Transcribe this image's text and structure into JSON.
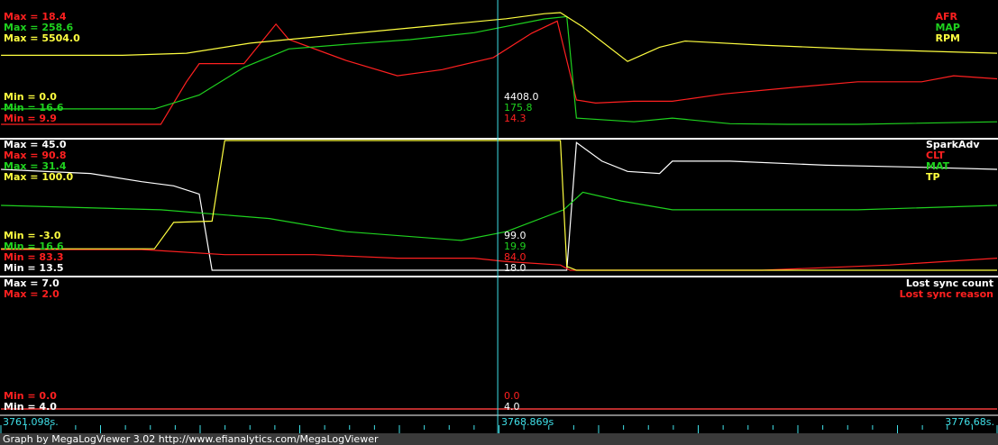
{
  "footer": "Graph by MegaLogViewer 3.02 http://www.efianalytics.com/MegaLogViewer",
  "colors": {
    "red": "#ff2020",
    "green": "#1fd21f",
    "yellow": "#ffff40",
    "white": "#ffffff",
    "cyan": "#40e0e8"
  },
  "time_axis": {
    "start": "3761.098s.",
    "cursor": "3768.869s",
    "end": "3776.68s."
  },
  "panel1": {
    "legend": [
      "AFR",
      "MAP",
      "RPM"
    ],
    "max": [
      "Max = 18.4",
      "Max = 258.6",
      "Max = 5504.0"
    ],
    "min": [
      "Min = 0.0",
      "Min = 16.6",
      "Min = 9.9"
    ],
    "cursor": [
      "4408.0",
      "175.8",
      "14.3"
    ]
  },
  "panel2": {
    "legend": [
      "SparkAdv",
      "CLT",
      "MAT",
      "TP"
    ],
    "max": [
      "Max = 45.0",
      "Max = 90.8",
      "Max = 31.4",
      "Max = 100.0"
    ],
    "min": [
      "Min = -3.0",
      "Min = 16.6",
      "Min = 83.3",
      "Min = 13.5"
    ],
    "cursor": [
      "99.0",
      "19.9",
      "84.0",
      "18.0"
    ]
  },
  "panel3": {
    "legend": [
      "Lost sync count",
      "Lost sync reason"
    ],
    "max": [
      "Max = 7.0",
      "Max = 2.0"
    ],
    "min": [
      "Min = 0.0",
      "Min = 4.0"
    ],
    "cursor": [
      "0.0",
      "4.0"
    ]
  },
  "chart_data": {
    "type": "line",
    "x_range": [
      3761.098,
      3776.68
    ],
    "cursor_x": 3768.869,
    "panels": [
      {
        "series": [
          {
            "name": "AFR",
            "color": "#ff2020",
            "min": 0.0,
            "max": 18.4,
            "x": [
              3761.1,
              3763.6,
              3764.0,
              3764.2,
              3764.9,
              3765.4,
              3765.6,
              3766.5,
              3767.3,
              3768.0,
              3768.8,
              3769.4,
              3769.8,
              3770.1,
              3770.4,
              3771.0,
              3771.6,
              3772.4,
              3773.4,
              3774.5,
              3775.5,
              3776.0,
              3776.68
            ],
            "y": [
              0.0,
              0.0,
              7.0,
              10.0,
              10.0,
              16.5,
              14.0,
              10.5,
              8.0,
              9.0,
              11.0,
              15.0,
              17.0,
              4.0,
              3.5,
              3.8,
              3.8,
              5.0,
              6.0,
              7.0,
              7.0,
              8.0,
              7.5
            ]
          },
          {
            "name": "MAP",
            "color": "#1fd21f",
            "min": 16.6,
            "max": 258.6,
            "x": [
              3761.1,
              3763.5,
              3764.2,
              3764.9,
              3765.6,
              3766.5,
              3767.5,
              3768.5,
              3769.6,
              3769.95,
              3770.1,
              3771.0,
              3771.6,
              3772.5,
              3773.4,
              3774.5,
              3776.68
            ],
            "y": [
              50.0,
              50.0,
              80.0,
              140.0,
              180.0,
              190.0,
              200.0,
              215.0,
              245.0,
              250.0,
              30.0,
              22.0,
              30.0,
              18.0,
              16.6,
              16.6,
              22.0
            ]
          },
          {
            "name": "RPM",
            "color": "#ffff40",
            "min": 0.0,
            "max": 5504.0,
            "x": [
              3761.1,
              3763.0,
              3764.0,
              3765.0,
              3766.0,
              3767.0,
              3768.0,
              3769.0,
              3769.6,
              3769.85,
              3770.2,
              3770.9,
              3771.4,
              3771.8,
              3773.0,
              3774.5,
              3776.68
            ],
            "y": [
              3400.0,
              3400.0,
              3500.0,
              4000.0,
              4300.0,
              4600.0,
              4900.0,
              5200.0,
              5450.0,
              5504.0,
              4800.0,
              3100.0,
              3800.0,
              4100.0,
              3900.0,
              3700.0,
              3500.0
            ]
          }
        ]
      },
      {
        "series": [
          {
            "name": "SparkAdv",
            "color": "#ffffff",
            "min": 13.5,
            "max": 45.0,
            "x": [
              3761.1,
              3762.5,
              3763.3,
              3763.8,
              3764.2,
              3764.4,
              3766.0,
              3768.8,
              3769.85,
              3769.95,
              3770.1,
              3770.5,
              3770.9,
              3771.4,
              3771.6,
              3772.5,
              3774.0,
              3775.5,
              3776.68
            ],
            "y": [
              38.0,
              37.0,
              35.0,
              34.0,
              32.0,
              13.5,
              13.5,
              13.5,
              13.5,
              13.5,
              44.5,
              40.0,
              37.5,
              37.0,
              40.0,
              40.0,
              39.0,
              38.5,
              38.0
            ]
          },
          {
            "name": "CLT",
            "color": "#ff2020",
            "min": 83.3,
            "max": 90.8,
            "x": [
              3761.1,
              3763.3,
              3764.6,
              3766.0,
              3767.3,
              3768.5,
              3769.0,
              3769.85,
              3770.0,
              3771.4,
              3773.0,
              3775.0,
              3776.68
            ],
            "y": [
              84.5,
              84.5,
              84.2,
              84.2,
              84.0,
              84.0,
              83.8,
              83.6,
              83.3,
              83.3,
              83.3,
              83.6,
              84.0
            ]
          },
          {
            "name": "MAT",
            "color": "#1fd21f",
            "min": 16.6,
            "max": 31.4,
            "x": [
              3761.1,
              3763.6,
              3765.3,
              3766.5,
              3768.3,
              3769.0,
              3769.9,
              3770.2,
              3770.8,
              3771.6,
              3773.0,
              3774.5,
              3776.68
            ],
            "y": [
              24.0,
              23.5,
              22.5,
              21.0,
              20.0,
              21.0,
              23.5,
              25.5,
              24.5,
              23.5,
              23.5,
              23.5,
              24.0
            ]
          },
          {
            "name": "TP",
            "color": "#ffff40",
            "min": -3.0,
            "max": 100.0,
            "x": [
              3761.1,
              3763.5,
              3763.8,
              3764.4,
              3764.6,
              3769.85,
              3769.95,
              3770.1,
              3776.68
            ],
            "y": [
              14.0,
              14.0,
              35.0,
              36.0,
              100.0,
              100.0,
              0.0,
              -3.0,
              -3.0
            ]
          }
        ]
      },
      {
        "series": [
          {
            "name": "Lost sync count",
            "color": "#ffffff",
            "min": 4.0,
            "max": 7.0,
            "x": [
              3761.1,
              3776.68
            ],
            "y": [
              4.0,
              4.0
            ]
          },
          {
            "name": "Lost sync reason",
            "color": "#ff2020",
            "min": 0.0,
            "max": 2.0,
            "x": [
              3761.1,
              3776.68
            ],
            "y": [
              0.0,
              0.0
            ]
          }
        ]
      }
    ]
  }
}
